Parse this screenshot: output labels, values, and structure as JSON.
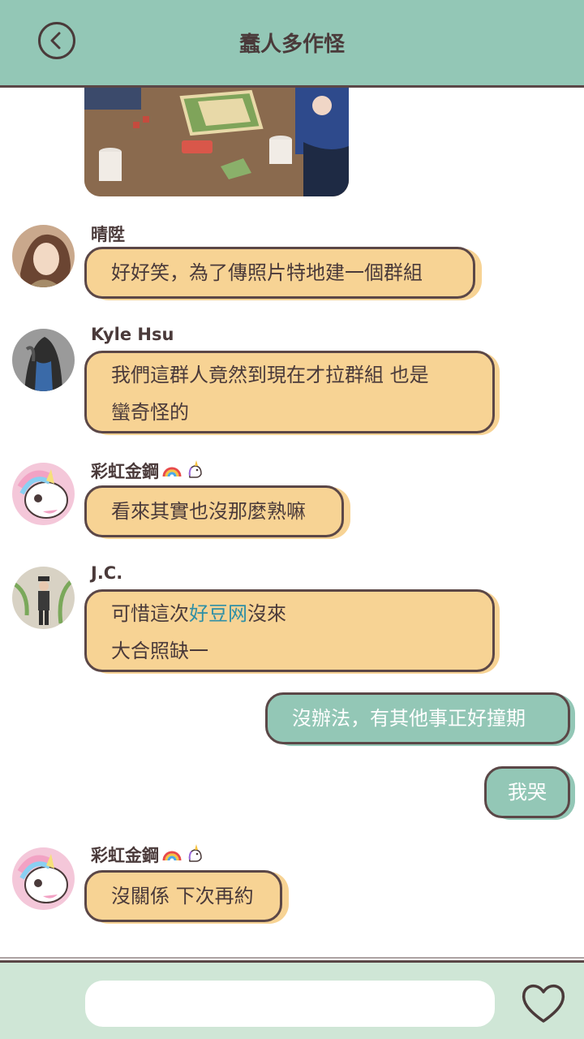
{
  "header": {
    "title": "蠢人多作怪",
    "back_icon": "chevron-left-icon"
  },
  "messages": [
    {
      "sender": "晴陞",
      "text": "好好笑，為了傳照片特地建一個群組"
    },
    {
      "sender": "Kyle Hsu",
      "line1": "我們這群人竟然到現在才拉群組 也是",
      "line2": "蠻奇怪的"
    },
    {
      "sender": "彩虹金鋼",
      "text": "看來其實也沒那麼熟嘛"
    },
    {
      "sender": "J.C.",
      "line1_pre": "可惜這次",
      "line1_link": "好豆网",
      "line1_post": "沒來",
      "line2": "大合照缺一"
    },
    {
      "text": "沒辦法，有其他事正好撞期"
    },
    {
      "text": "我哭"
    },
    {
      "sender": "彩虹金鋼",
      "text": "沒關係 下次再約"
    }
  ],
  "composer": {
    "placeholder": "",
    "heart_icon": "heart-icon"
  },
  "colors": {
    "header": "#93c7b6",
    "bubble_other": "#f7d394",
    "bubble_mine": "#93c7b6",
    "outline": "#5b4747",
    "link": "#2e8fa6",
    "footer": "#cfe6d6"
  }
}
